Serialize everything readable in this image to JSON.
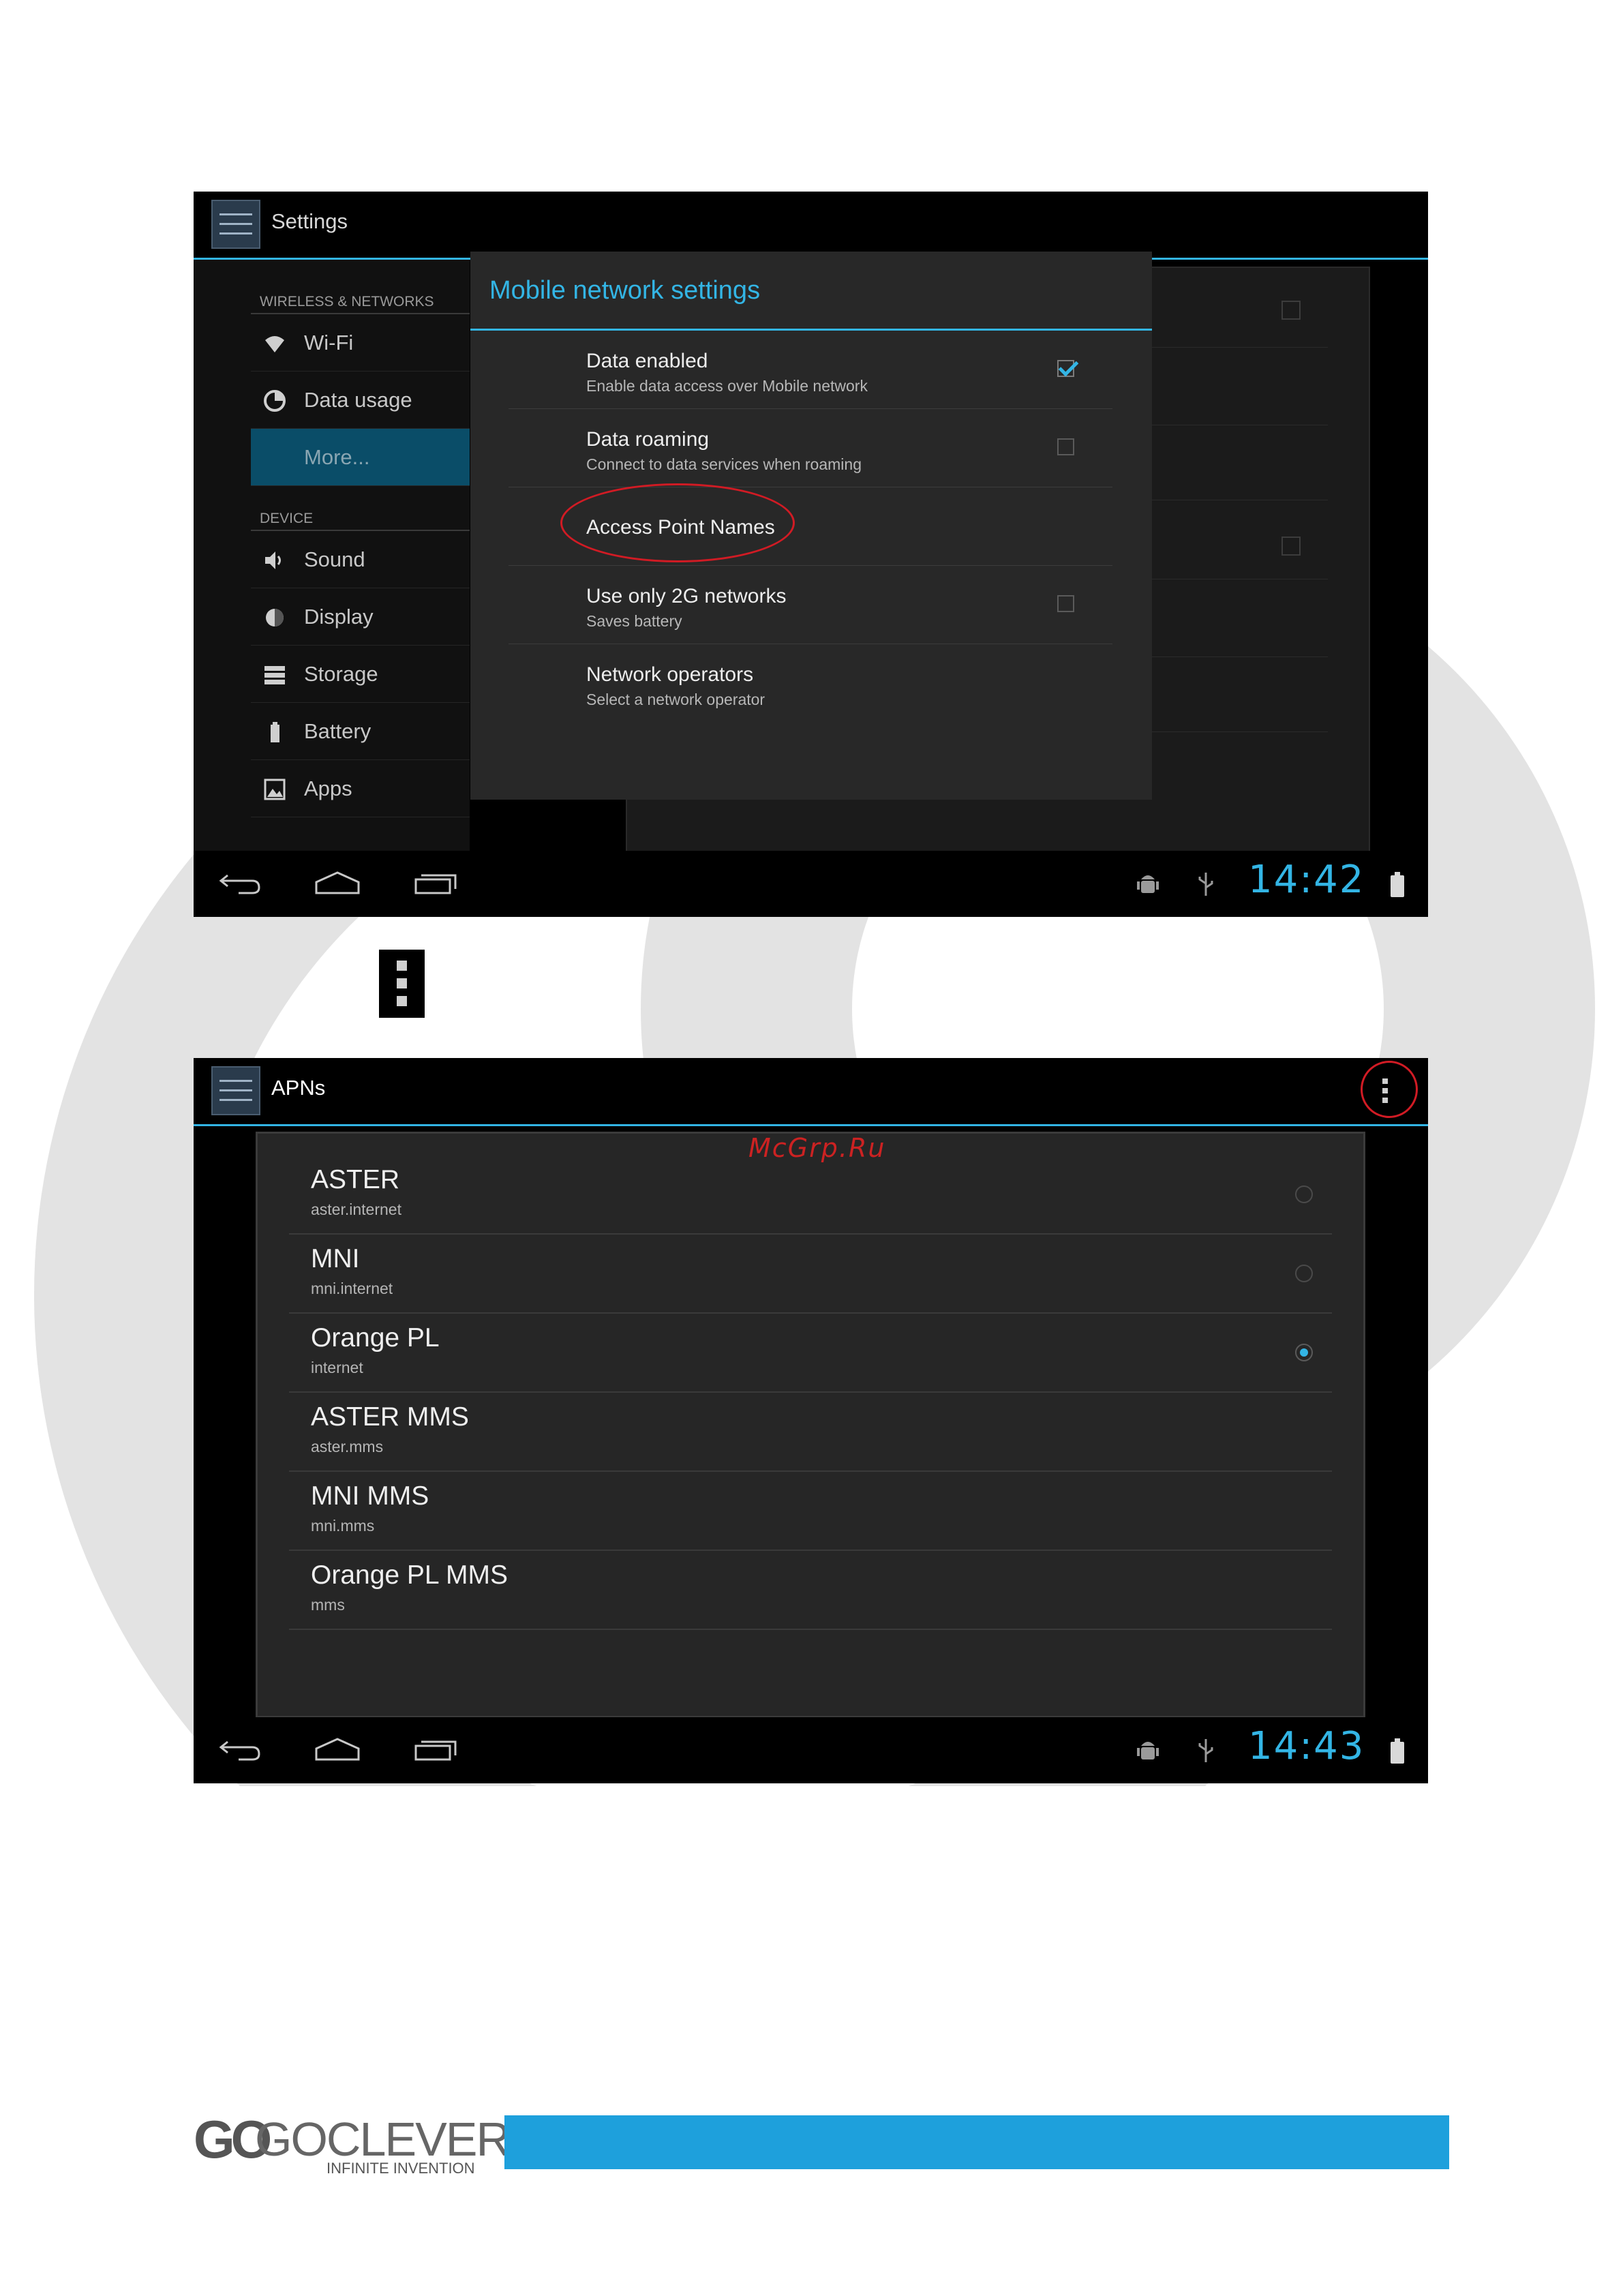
{
  "colors": {
    "accent": "#33b5e5",
    "highlight_oval": "#d11b24",
    "watermark": "#cc2222",
    "footer_bar": "#1ea0dc"
  },
  "screen1": {
    "title": "Settings",
    "sidebar": {
      "section_wireless": "WIRELESS & NETWORKS",
      "section_device": "DEVICE",
      "items": [
        {
          "label": "Wi-Fi",
          "icon": "wifi-icon",
          "selected": false
        },
        {
          "label": "Data usage",
          "icon": "data-usage-icon",
          "selected": false
        },
        {
          "label": "More...",
          "icon": "",
          "selected": true
        },
        {
          "label": "Sound",
          "icon": "speaker-icon",
          "selected": false
        },
        {
          "label": "Display",
          "icon": "brightness-icon",
          "selected": false
        },
        {
          "label": "Storage",
          "icon": "storage-icon",
          "selected": false
        },
        {
          "label": "Battery",
          "icon": "battery-icon",
          "selected": false
        },
        {
          "label": "Apps",
          "icon": "apps-icon",
          "selected": false
        }
      ]
    },
    "dialog": {
      "title": "Mobile network settings",
      "rows": [
        {
          "title": "Data enabled",
          "summary": "Enable data access over Mobile network",
          "checked": true
        },
        {
          "title": "Data roaming",
          "summary": "Connect to data services when roaming",
          "checked": false
        },
        {
          "title": "Access Point Names",
          "summary": "",
          "highlighted": true
        },
        {
          "title": "Use only 2G networks",
          "summary": "Saves battery",
          "checked": false
        },
        {
          "title": "Network operators",
          "summary": "Select a network operator"
        }
      ]
    },
    "status": {
      "time": "14:42"
    }
  },
  "menu_icon": "overflow-menu-icon",
  "screen2": {
    "title": "APNs",
    "watermark": "McGrp.Ru",
    "apns": [
      {
        "name": "ASTER",
        "apn": "aster.internet",
        "radio": true,
        "selected": false
      },
      {
        "name": "MNI",
        "apn": "mni.internet",
        "radio": true,
        "selected": false
      },
      {
        "name": "Orange PL",
        "apn": "internet",
        "radio": true,
        "selected": true
      },
      {
        "name": "ASTER MMS",
        "apn": "aster.mms",
        "radio": false
      },
      {
        "name": "MNI MMS",
        "apn": "mni.mms",
        "radio": false
      },
      {
        "name": "Orange PL MMS",
        "apn": "mms",
        "radio": false
      }
    ],
    "status": {
      "time": "14:43"
    }
  },
  "footer": {
    "logo_go": "GO",
    "logo_name": "GOCLEVER",
    "logo_tagline": "INFINITE INVENTION"
  }
}
